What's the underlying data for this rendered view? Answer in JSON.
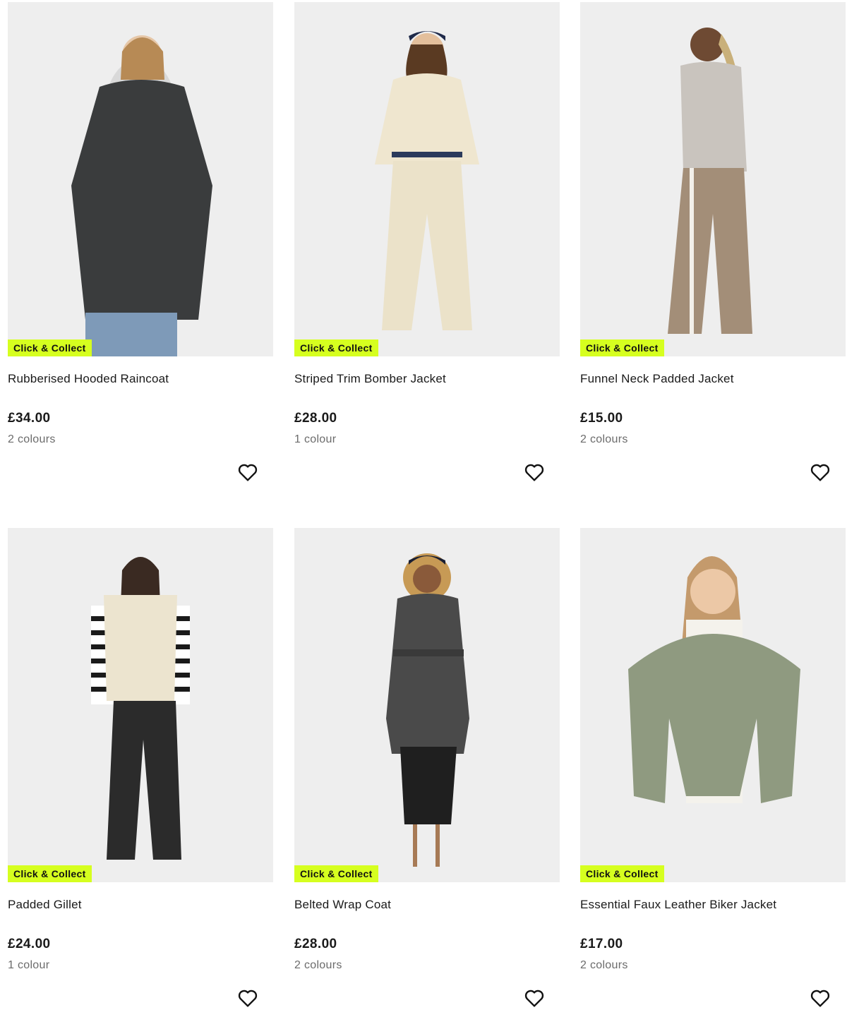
{
  "products": [
    {
      "name": "Rubberised Hooded Raincoat",
      "price": "£34.00",
      "colours": "2 colours",
      "badge": "Click & Collect",
      "garment_color": "#3a3c3d",
      "bottom_color": "#7e9ab8"
    },
    {
      "name": "Striped Trim Bomber Jacket",
      "price": "£28.00",
      "colours": "1 colour",
      "badge": "Click & Collect",
      "garment_color": "#efe6cf",
      "bottom_color": "#ebe2c9"
    },
    {
      "name": "Funnel Neck Padded Jacket",
      "price": "£15.00",
      "colours": "2 colours",
      "badge": "Click & Collect",
      "garment_color": "#c9c4be",
      "bottom_color": "#a38e78"
    },
    {
      "name": "Padded Gillet",
      "price": "£24.00",
      "colours": "1 colour",
      "badge": "Click & Collect",
      "garment_color": "#ece4cf",
      "bottom_color": "#2b2b2b"
    },
    {
      "name": "Belted Wrap Coat",
      "price": "£28.00",
      "colours": "2 colours",
      "badge": "Click & Collect",
      "garment_color": "#4a4a4a",
      "bottom_color": "#1f1f1f"
    },
    {
      "name": "Essential Faux Leather Biker Jacket",
      "price": "£17.00",
      "colours": "2 colours",
      "badge": "Click & Collect",
      "garment_color": "#8f9a80",
      "bottom_color": "#eeeeee"
    }
  ],
  "icons": {
    "wishlist": "heart-outline-icon"
  },
  "colors": {
    "badge_bg": "#d6ff1f",
    "tile_bg": "#efefef",
    "muted_text": "#6b6b6b"
  }
}
